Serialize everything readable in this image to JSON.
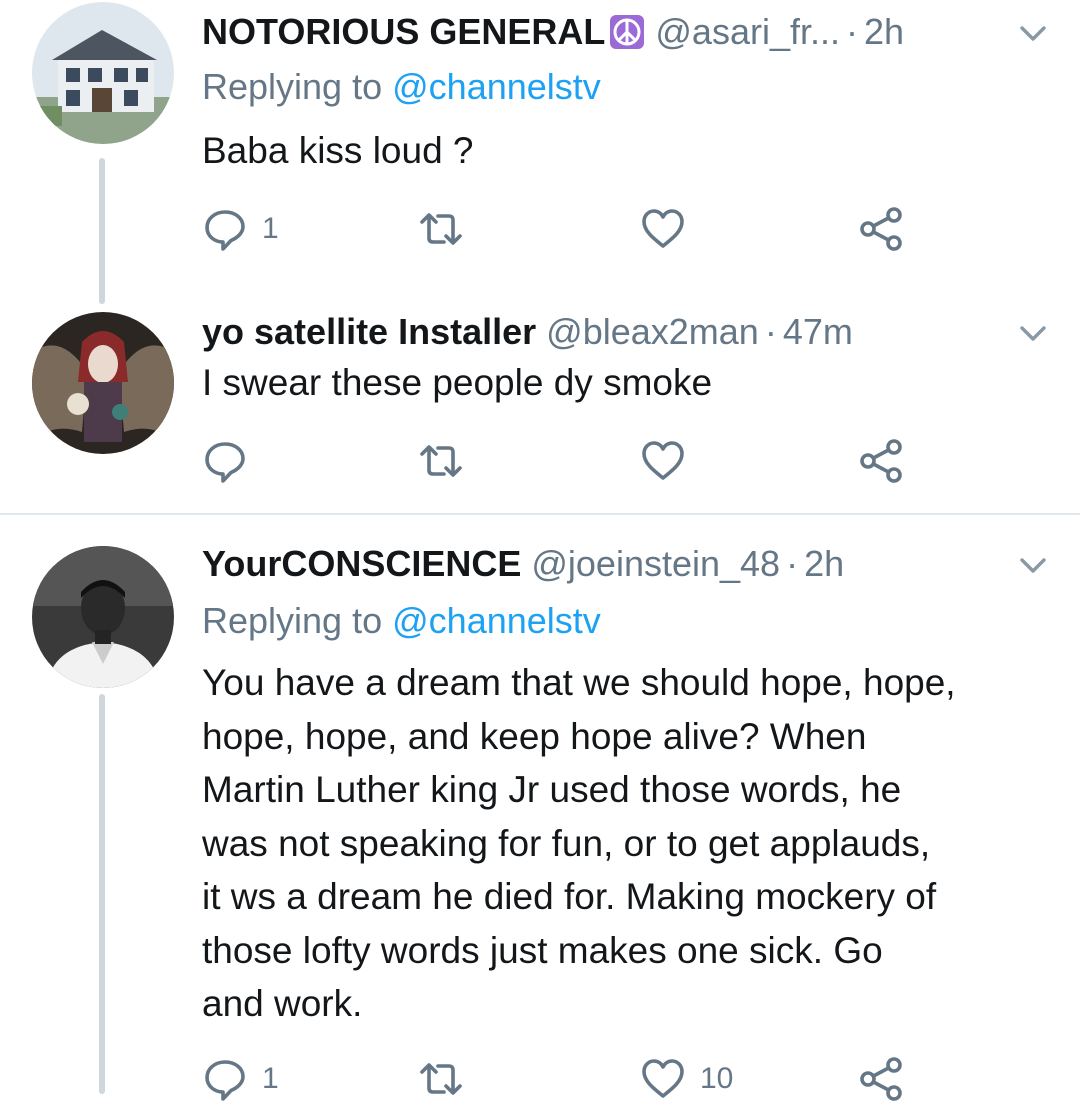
{
  "tweets": [
    {
      "name": "NOTORIOUS GENERAL",
      "handle": "@asari_fr...",
      "dot": "·",
      "time": "2h",
      "replying_prefix": "Replying to",
      "replying_to": "@channelstv",
      "lines": [
        "Baba kiss loud ?"
      ],
      "reply_count": "1",
      "retweet_count": "",
      "like_count": ""
    },
    {
      "name": "yo satellite Installer",
      "handle": "@bleax2man",
      "dot": "·",
      "time": "47m",
      "lines": [
        "I swear these people dy smoke"
      ],
      "reply_count": "",
      "retweet_count": "",
      "like_count": ""
    },
    {
      "name": "YourCONSCIENCE",
      "handle": "@joeinstein_48",
      "dot": "·",
      "time": "2h",
      "replying_prefix": "Replying to",
      "replying_to": "@channelstv",
      "lines": [
        "You have a dream that we should hope, hope,",
        "hope, hope, and keep hope alive?  When",
        "Martin Luther king Jr used those words, he",
        "was not speaking for fun, or to get applauds,",
        "it ws a dream he died for. Making mockery of",
        "those lofty words just makes one sick. Go",
        "and work."
      ],
      "reply_count": "1",
      "like_count": "10"
    }
  ],
  "icons": [
    "reply-icon",
    "retweet-icon",
    "like-icon",
    "share-icon",
    "chevron-down-icon",
    "peace-symbol-icon"
  ],
  "colors": {
    "text": "#14171a",
    "secondary": "#657786",
    "link": "#1da1f2",
    "thread": "#cfd6dc",
    "divider": "#e1e8ed"
  }
}
